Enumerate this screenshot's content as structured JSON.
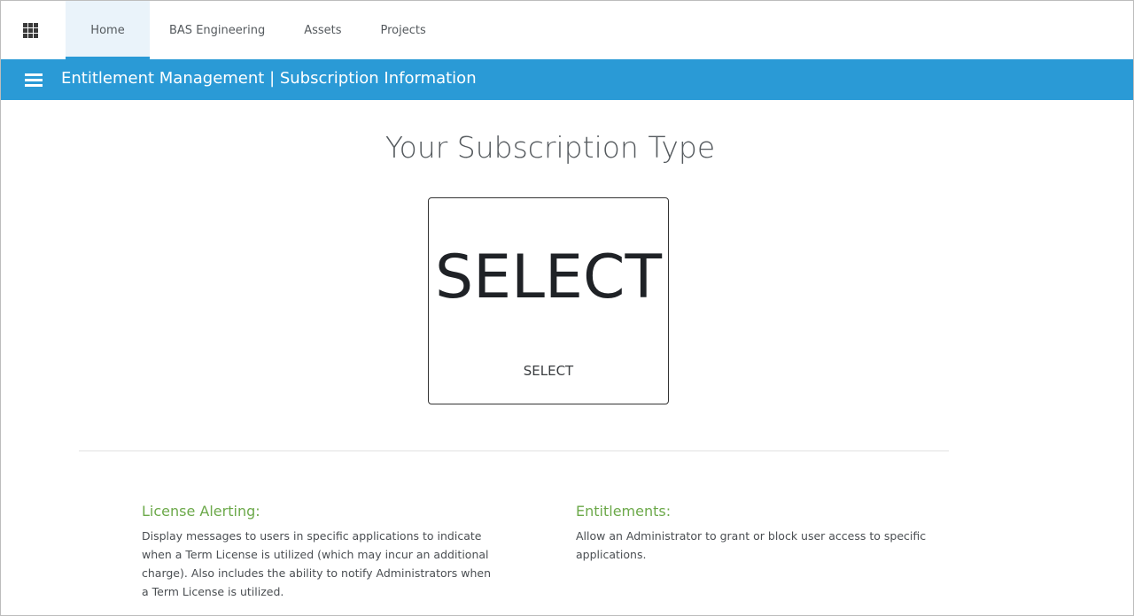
{
  "nav": {
    "tabs": [
      {
        "label": "Home",
        "active": true
      },
      {
        "label": "BAS Engineering",
        "active": false
      },
      {
        "label": "Assets",
        "active": false
      },
      {
        "label": "Projects",
        "active": false
      }
    ]
  },
  "header": {
    "title": "Entitlement Management | Subscription Information"
  },
  "main": {
    "title": "Your Subscription Type",
    "subscription": {
      "big_label": "SELECT",
      "small_label": "SELECT"
    },
    "features": [
      {
        "heading": "License Alerting:",
        "description": "Display messages to users in specific applications to indicate when a Term License is utilized (which may incur an additional charge). Also includes the ability to notify Administrators when a Term License is utilized."
      },
      {
        "heading": "Entitlements:",
        "description": "Allow an Administrator to grant or block user access to specific applications."
      }
    ]
  },
  "colors": {
    "header_blue": "#2a9ad6",
    "active_tab_bg": "#eaf3fa",
    "feature_heading_green": "#6ca94a"
  },
  "icons": {
    "apps": "app-grid-icon",
    "menu": "hamburger-menu-icon"
  }
}
